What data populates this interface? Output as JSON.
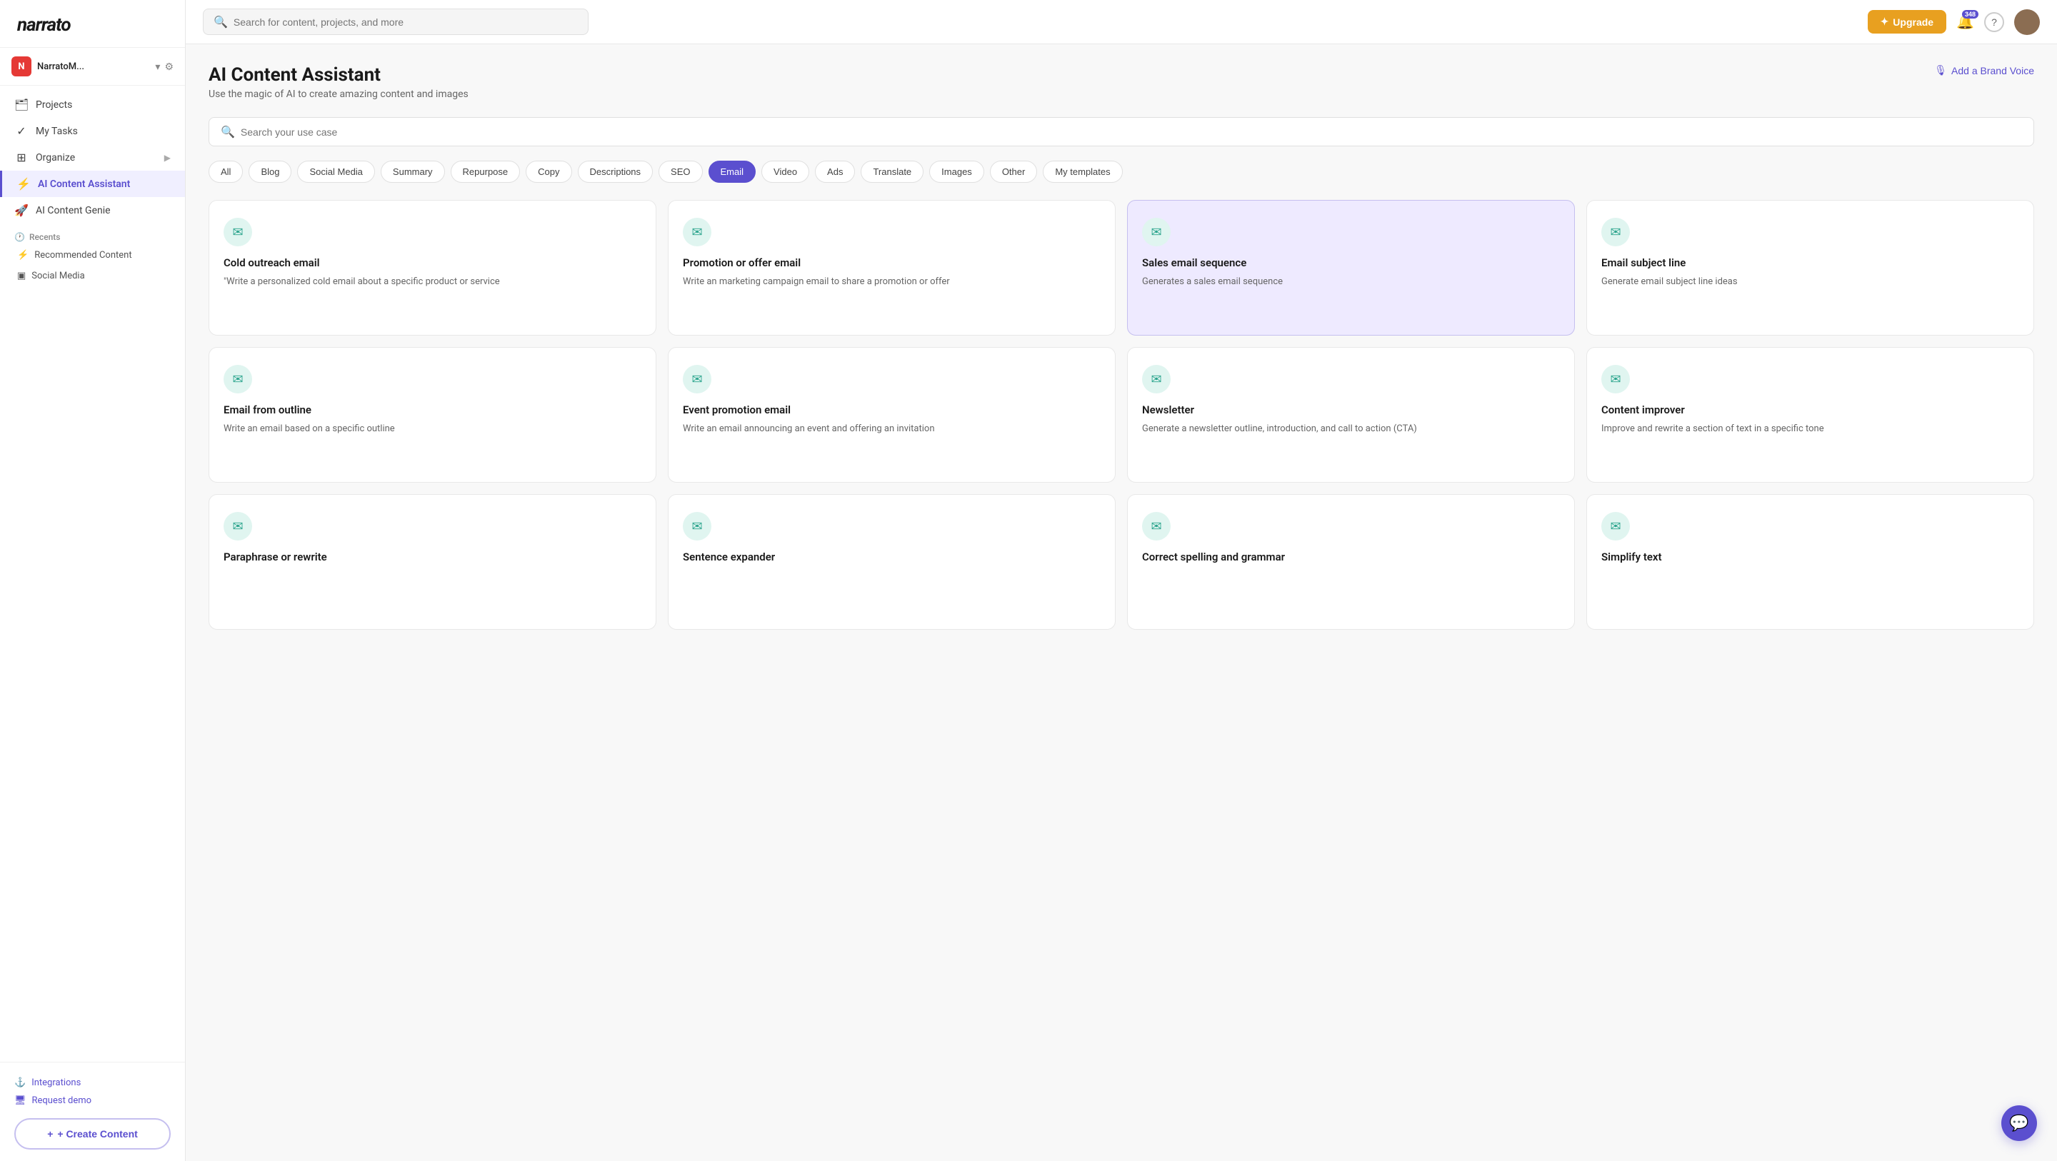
{
  "sidebar": {
    "logo": "narrato",
    "workspace": {
      "initial": "N",
      "name": "NarratoM..."
    },
    "nav_items": [
      {
        "id": "projects",
        "icon": "🗂",
        "label": "Projects"
      },
      {
        "id": "my-tasks",
        "icon": "✓",
        "label": "My Tasks"
      },
      {
        "id": "organize",
        "icon": "⊞",
        "label": "Organize",
        "has_arrow": true
      },
      {
        "id": "ai-content-assistant",
        "icon": "⚡",
        "label": "AI Content Assistant",
        "active": true
      },
      {
        "id": "ai-content-genie",
        "icon": "🚀",
        "label": "AI Content Genie"
      }
    ],
    "recents_title": "Recents",
    "recents": [
      {
        "id": "recommended",
        "icon": "⚡",
        "label": "Recommended Content"
      },
      {
        "id": "social-media",
        "icon": "▣",
        "label": "Social Media"
      }
    ],
    "integrations_label": "Integrations",
    "request_demo_label": "Request demo",
    "create_content_label": "+ Create Content"
  },
  "topbar": {
    "search_placeholder": "Search for content, projects, and more",
    "upgrade_label": "Upgrade",
    "notification_count": "348",
    "help_icon": "?"
  },
  "main": {
    "title": "AI Content Assistant",
    "subtitle": "Use the magic of AI to create amazing content and images",
    "add_brand_voice_label": "Add a Brand Voice",
    "use_case_search_placeholder": "Search your use case",
    "filter_tags": [
      {
        "id": "all",
        "label": "All"
      },
      {
        "id": "blog",
        "label": "Blog"
      },
      {
        "id": "social-media",
        "label": "Social Media"
      },
      {
        "id": "summary",
        "label": "Summary"
      },
      {
        "id": "repurpose",
        "label": "Repurpose"
      },
      {
        "id": "copy",
        "label": "Copy"
      },
      {
        "id": "descriptions",
        "label": "Descriptions"
      },
      {
        "id": "seo",
        "label": "SEO"
      },
      {
        "id": "email",
        "label": "Email",
        "active": true
      },
      {
        "id": "video",
        "label": "Video"
      },
      {
        "id": "ads",
        "label": "Ads"
      },
      {
        "id": "translate",
        "label": "Translate"
      },
      {
        "id": "images",
        "label": "Images"
      },
      {
        "id": "other",
        "label": "Other"
      },
      {
        "id": "my-templates",
        "label": "My templates"
      }
    ],
    "cards": [
      {
        "id": "cold-outreach-email",
        "icon": "✉",
        "title": "Cold outreach email",
        "desc": "\"Write a personalized cold email about a specific product or service",
        "highlighted": false
      },
      {
        "id": "promotion-or-offer-email",
        "icon": "✉",
        "title": "Promotion or offer email",
        "desc": "Write an marketing campaign email to share a promotion or offer",
        "highlighted": false
      },
      {
        "id": "sales-email-sequence",
        "icon": "✉",
        "title": "Sales email sequence",
        "desc": "Generates a sales email sequence",
        "highlighted": true
      },
      {
        "id": "email-subject-line",
        "icon": "✉",
        "title": "Email subject line",
        "desc": "Generate email subject line ideas",
        "highlighted": false
      },
      {
        "id": "email-from-outline",
        "icon": "✉",
        "title": "Email from outline",
        "desc": "Write an email based on a specific outline",
        "highlighted": false
      },
      {
        "id": "event-promotion-email",
        "icon": "✉",
        "title": "Event promotion email",
        "desc": "Write an email announcing an event and offering an invitation",
        "highlighted": false
      },
      {
        "id": "newsletter",
        "icon": "✉",
        "title": "Newsletter",
        "desc": "Generate a newsletter outline, introduction, and call to action (CTA)",
        "highlighted": false
      },
      {
        "id": "content-improver",
        "icon": "✉",
        "title": "Content improver",
        "desc": "Improve and rewrite a section of text in a specific tone",
        "highlighted": false
      },
      {
        "id": "paraphrase-or-rewrite",
        "icon": "✉",
        "title": "Paraphrase or rewrite",
        "desc": "",
        "highlighted": false
      },
      {
        "id": "sentence-expander",
        "icon": "✉",
        "title": "Sentence expander",
        "desc": "",
        "highlighted": false
      },
      {
        "id": "correct-spelling-and-grammar",
        "icon": "✉",
        "title": "Correct spelling and grammar",
        "desc": "",
        "highlighted": false
      },
      {
        "id": "simplify-text",
        "icon": "✉",
        "title": "Simplify text",
        "desc": "",
        "highlighted": false
      }
    ]
  }
}
